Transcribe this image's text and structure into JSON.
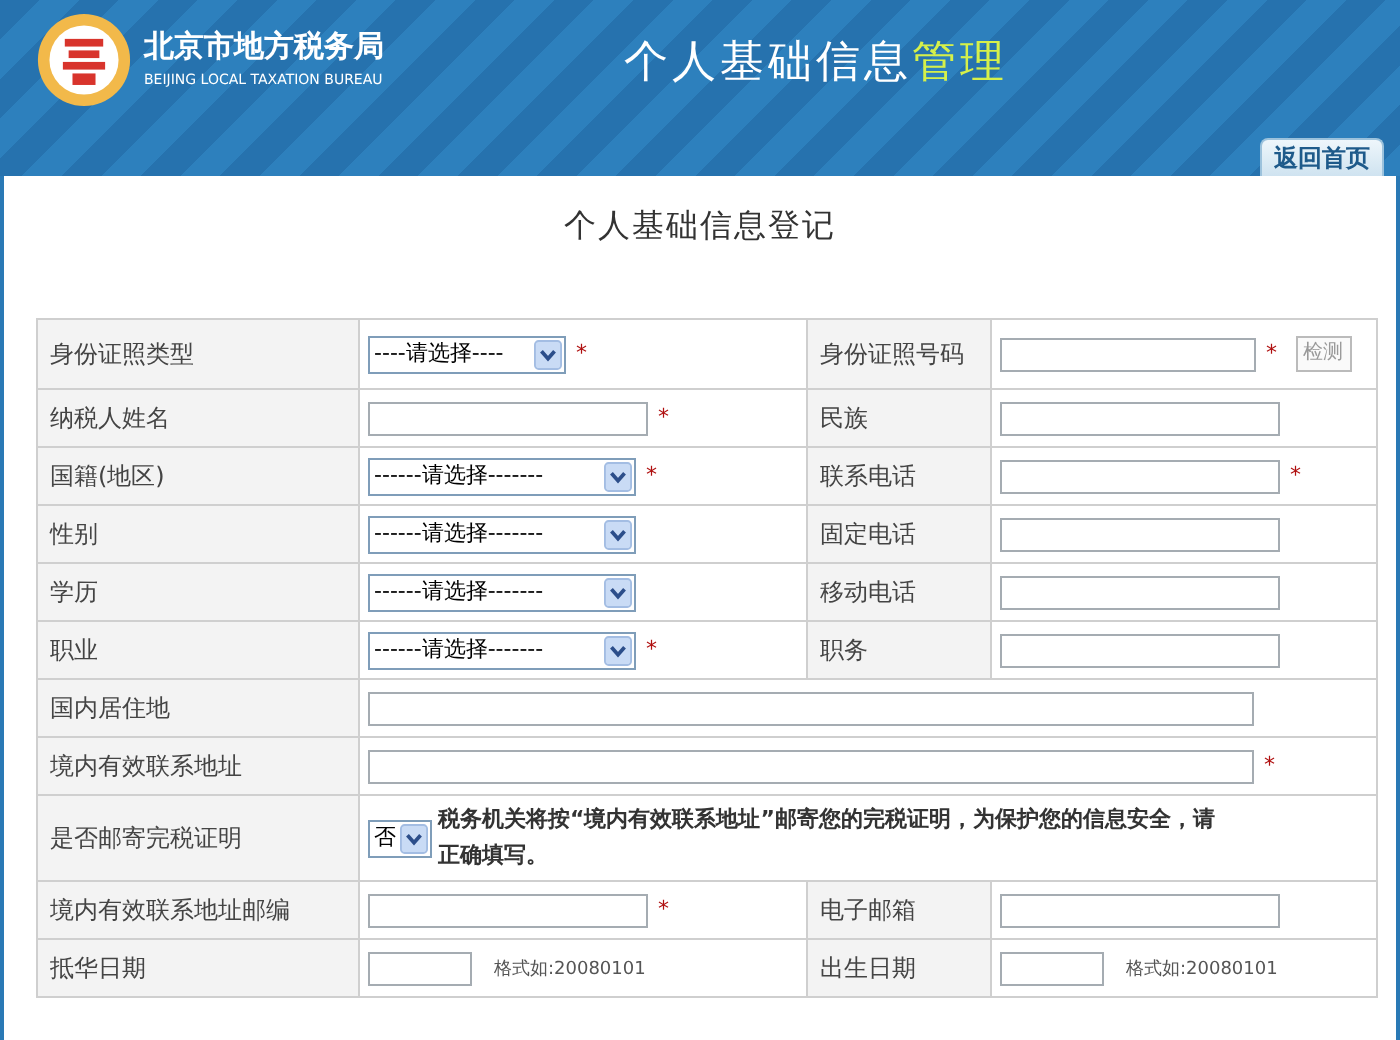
{
  "header": {
    "org_name": "北京市地方税务局",
    "org_name_en": "BEIJING LOCAL TAXATION BUREAU",
    "title": [
      {
        "text": "个人基础信息",
        "highlight": false
      },
      {
        "text": "管理",
        "highlight": true
      }
    ]
  },
  "back_tab": "返回首页",
  "form": {
    "title": "个人基础信息登记",
    "rows": [
      {
        "label": "身份证照类型",
        "field": {
          "kind": "select",
          "value": "----请选择----",
          "mark": "*"
        },
        "label2": "身份证照号码",
        "field2": {
          "kind": "text",
          "mark": "*",
          "button": "检测"
        }
      },
      {
        "label": "纳税人姓名",
        "field": {
          "kind": "text",
          "mark": "*"
        },
        "label2": "民族",
        "field2": {
          "kind": "text"
        }
      },
      {
        "label": "国籍(地区)",
        "field": {
          "kind": "select",
          "value": "------请选择-------",
          "mark": "*"
        },
        "label2": "联系电话",
        "field2": {
          "kind": "text",
          "mark": "*"
        }
      },
      {
        "label": "性别",
        "field": {
          "kind": "select",
          "value": "------请选择-------"
        },
        "label2": "固定电话",
        "field2": {
          "kind": "text"
        }
      },
      {
        "label": "学历",
        "field": {
          "kind": "select",
          "value": "------请选择-------"
        },
        "label2": "移动电话",
        "field2": {
          "kind": "text"
        }
      },
      {
        "label": "职业",
        "field": {
          "kind": "select",
          "value": "------请选择-------",
          "mark": "*"
        },
        "label2": "职务",
        "field2": {
          "kind": "text"
        }
      },
      {
        "label": "国内居住地",
        "field": {
          "kind": "text"
        }
      },
      {
        "label": "境内有效联系地址",
        "field": {
          "kind": "text",
          "mark": "*"
        }
      },
      {
        "label": "是否邮寄完税证明",
        "field": {
          "kind": "select",
          "value": "否",
          "note": "税务机关将按“境内有效联系地址”邮寄您的完税证明，为保护您的信息安全，请正确填写。"
        }
      },
      {
        "label": "境内有效联系地址邮编",
        "field": {
          "kind": "text",
          "mark": "*"
        },
        "label2": "电子邮箱",
        "field2": {
          "kind": "text"
        }
      },
      {
        "label": "抵华日期",
        "field": {
          "kind": "text",
          "hint": "格式如:20080101"
        },
        "label2": "出生日期",
        "field2": {
          "kind": "text",
          "hint": "格式如:20080101"
        }
      }
    ]
  }
}
